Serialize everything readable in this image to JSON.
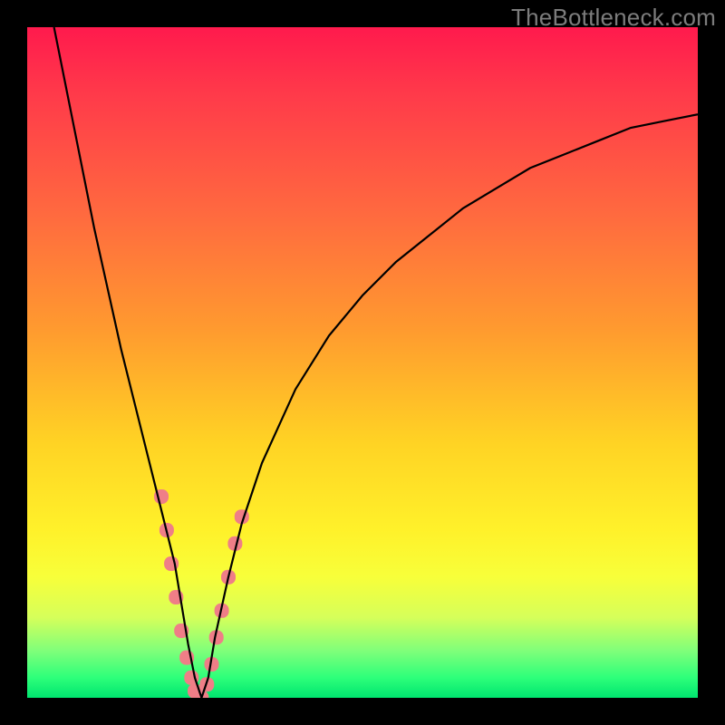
{
  "branding": {
    "watermark": "TheBottleneck.com"
  },
  "chart_data": {
    "type": "line",
    "title": "",
    "xlabel": "",
    "ylabel": "",
    "xlim": [
      0,
      100
    ],
    "ylim": [
      0,
      100
    ],
    "grid": false,
    "legend": false,
    "background_gradient": {
      "direction": "top-to-bottom",
      "stops": [
        {
          "pos": 0,
          "color": "#ff1a4d"
        },
        {
          "pos": 28,
          "color": "#ff6a3f"
        },
        {
          "pos": 62,
          "color": "#ffd324"
        },
        {
          "pos": 82,
          "color": "#f7ff3a"
        },
        {
          "pos": 97,
          "color": "#2dff7a"
        },
        {
          "pos": 100,
          "color": "#00e56f"
        }
      ]
    },
    "series": [
      {
        "name": "bottleneck-curve",
        "color": "#000000",
        "stroke_width": 2.2,
        "x": [
          4,
          6,
          8,
          10,
          12,
          14,
          16,
          18,
          20,
          21,
          22,
          23,
          24,
          25,
          26,
          27,
          28,
          30,
          32,
          35,
          40,
          45,
          50,
          55,
          60,
          65,
          70,
          75,
          80,
          85,
          90,
          95,
          100
        ],
        "y": [
          100,
          90,
          80,
          70,
          61,
          52,
          44,
          36,
          28,
          24,
          20,
          14,
          8,
          3,
          0,
          3,
          9,
          18,
          26,
          35,
          46,
          54,
          60,
          65,
          69,
          73,
          76,
          79,
          81,
          83,
          85,
          86,
          87
        ]
      }
    ],
    "markers": [
      {
        "name": "highlight-dots",
        "shape": "rounded-rect",
        "color": "#ef7e87",
        "size": 16,
        "points": [
          {
            "x": 20.0,
            "y": 30
          },
          {
            "x": 20.8,
            "y": 25
          },
          {
            "x": 21.5,
            "y": 20
          },
          {
            "x": 22.2,
            "y": 15
          },
          {
            "x": 23.0,
            "y": 10
          },
          {
            "x": 23.8,
            "y": 6
          },
          {
            "x": 24.5,
            "y": 3
          },
          {
            "x": 25.0,
            "y": 1
          },
          {
            "x": 25.5,
            "y": 0
          },
          {
            "x": 26.0,
            "y": 0
          },
          {
            "x": 26.8,
            "y": 2
          },
          {
            "x": 27.5,
            "y": 5
          },
          {
            "x": 28.2,
            "y": 9
          },
          {
            "x": 29.0,
            "y": 13
          },
          {
            "x": 30.0,
            "y": 18
          },
          {
            "x": 31.0,
            "y": 23
          },
          {
            "x": 32.0,
            "y": 27
          }
        ]
      }
    ]
  }
}
